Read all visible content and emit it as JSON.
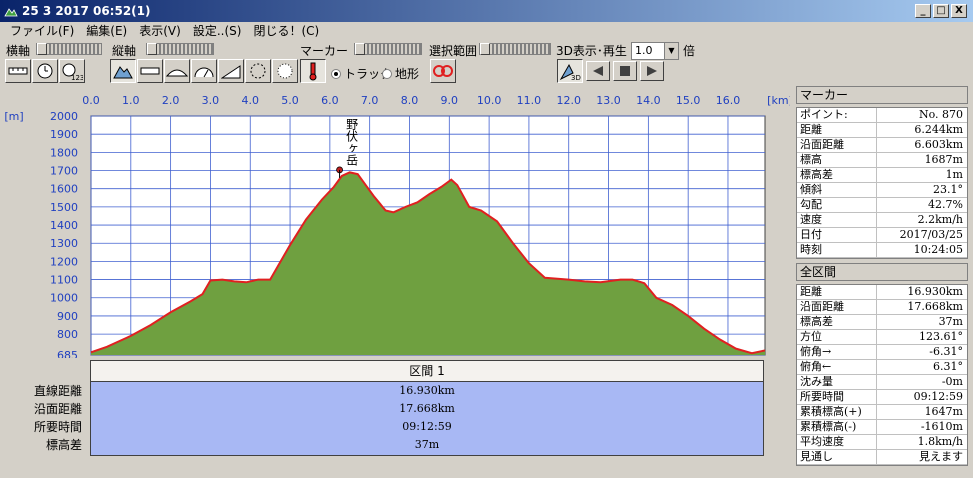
{
  "window": {
    "title": "25 3 2017 06:52(1)",
    "min": "_",
    "max": "□",
    "close": "X"
  },
  "menu": [
    "ファイル(F)",
    "編集(E)",
    "表示(V)",
    "設定..(S)",
    "閉じる！(C)"
  ],
  "toolbar": {
    "h_axis_label": "横軸",
    "v_axis_label": "縦軸",
    "marker_label": "マーカー",
    "track_label": "トラック",
    "terrain_label": "地形",
    "marker_mode": "track",
    "range_label": "選択範囲",
    "play3d_label": "3D表示･再生",
    "speed_value": "1.0",
    "speed_unit": "倍",
    "btn_3d": "3D",
    "btn_123": "123"
  },
  "chart_data": {
    "type": "area",
    "x_unit": "[km]",
    "y_unit": "[m]",
    "x_ticks": [
      "0.0",
      "1.0",
      "2.0",
      "3.0",
      "4.0",
      "5.0",
      "6.0",
      "7.0",
      "8.0",
      "9.0",
      "10.0",
      "11.0",
      "12.0",
      "13.0",
      "14.0",
      "15.0",
      "16.0"
    ],
    "y_ticks": [
      "2000",
      "1900",
      "1800",
      "1700",
      "1600",
      "1500",
      "1400",
      "1300",
      "1200",
      "1100",
      "1000",
      "900",
      "800",
      "685"
    ],
    "xlim": [
      0,
      16.93
    ],
    "ylim": [
      685,
      2000
    ],
    "grid": true,
    "fill_color": "#6fa040",
    "line_color": "#e02020",
    "annotation": {
      "text": "野伏ヶ岳",
      "x": 6.244,
      "y": 1687
    },
    "x": [
      0.0,
      0.4,
      1.0,
      1.5,
      2.0,
      2.5,
      2.8,
      3.0,
      3.3,
      3.6,
      3.9,
      4.2,
      4.5,
      5.0,
      5.4,
      5.8,
      6.1,
      6.3,
      6.5,
      6.7,
      6.9,
      7.1,
      7.4,
      7.6,
      7.9,
      8.2,
      8.5,
      8.8,
      9.05,
      9.2,
      9.5,
      9.8,
      10.2,
      10.6,
      11.0,
      11.4,
      12.0,
      12.4,
      12.8,
      13.3,
      13.6,
      13.9,
      14.2,
      14.6,
      15.0,
      15.4,
      15.8,
      16.2,
      16.6,
      16.93
    ],
    "y": [
      700,
      730,
      790,
      850,
      920,
      980,
      1020,
      1095,
      1100,
      1090,
      1085,
      1100,
      1100,
      1290,
      1430,
      1540,
      1610,
      1670,
      1690,
      1680,
      1620,
      1560,
      1480,
      1470,
      1500,
      1525,
      1570,
      1610,
      1650,
      1620,
      1500,
      1480,
      1420,
      1300,
      1190,
      1110,
      1100,
      1090,
      1085,
      1100,
      1100,
      1080,
      1000,
      960,
      900,
      830,
      770,
      720,
      695,
      710
    ]
  },
  "marker_panel": {
    "title": "マーカー",
    "rows": [
      {
        "k": "ポイント:",
        "v": "No. 870"
      },
      {
        "k": "距離",
        "v": "6.244km"
      },
      {
        "k": "沿面距離",
        "v": "6.603km"
      },
      {
        "k": "標高",
        "v": "1687m"
      },
      {
        "k": "標高差",
        "v": "1m"
      },
      {
        "k": "傾斜",
        "v": "23.1°"
      },
      {
        "k": "勾配",
        "v": "42.7%"
      },
      {
        "k": "速度",
        "v": "2.2km/h"
      },
      {
        "k": "日付",
        "v": "2017/03/25"
      },
      {
        "k": "時刻",
        "v": "10:24:05"
      }
    ]
  },
  "total_panel": {
    "title": "全区間",
    "rows": [
      {
        "k": "距離",
        "v": "16.930km"
      },
      {
        "k": "沿面距離",
        "v": "17.668km"
      },
      {
        "k": "標高差",
        "v": "37m"
      },
      {
        "k": "方位",
        "v": "123.61°"
      },
      {
        "k": "俯角→",
        "v": "-6.31°"
      },
      {
        "k": "俯角←",
        "v": "6.31°"
      },
      {
        "k": "沈み量",
        "v": "-0m"
      },
      {
        "k": "所要時間",
        "v": "09:12:59"
      },
      {
        "k": "累積標高(+)",
        "v": "1647m"
      },
      {
        "k": "累積標高(-)",
        "v": "-1610m"
      },
      {
        "k": "平均速度",
        "v": "1.8km/h"
      },
      {
        "k": "見通し",
        "v": "見えます"
      }
    ]
  },
  "section": {
    "title": "区間 1",
    "labels": [
      "直線距離",
      "沿面距離",
      "所要時間",
      "標高差"
    ],
    "values": [
      "16.930km",
      "17.668km",
      "09:12:59",
      "37m"
    ]
  }
}
